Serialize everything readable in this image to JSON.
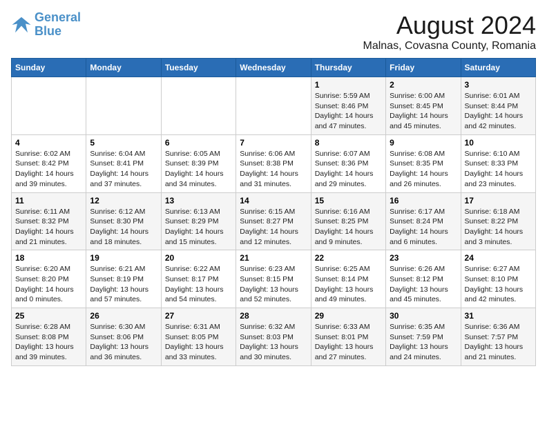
{
  "logo": {
    "line1": "General",
    "line2": "Blue"
  },
  "title": "August 2024",
  "location": "Malnas, Covasna County, Romania",
  "days_of_week": [
    "Sunday",
    "Monday",
    "Tuesday",
    "Wednesday",
    "Thursday",
    "Friday",
    "Saturday"
  ],
  "weeks": [
    [
      {
        "day": "",
        "info": ""
      },
      {
        "day": "",
        "info": ""
      },
      {
        "day": "",
        "info": ""
      },
      {
        "day": "",
        "info": ""
      },
      {
        "day": "1",
        "info": "Sunrise: 5:59 AM\nSunset: 8:46 PM\nDaylight: 14 hours and 47 minutes."
      },
      {
        "day": "2",
        "info": "Sunrise: 6:00 AM\nSunset: 8:45 PM\nDaylight: 14 hours and 45 minutes."
      },
      {
        "day": "3",
        "info": "Sunrise: 6:01 AM\nSunset: 8:44 PM\nDaylight: 14 hours and 42 minutes."
      }
    ],
    [
      {
        "day": "4",
        "info": "Sunrise: 6:02 AM\nSunset: 8:42 PM\nDaylight: 14 hours and 39 minutes."
      },
      {
        "day": "5",
        "info": "Sunrise: 6:04 AM\nSunset: 8:41 PM\nDaylight: 14 hours and 37 minutes."
      },
      {
        "day": "6",
        "info": "Sunrise: 6:05 AM\nSunset: 8:39 PM\nDaylight: 14 hours and 34 minutes."
      },
      {
        "day": "7",
        "info": "Sunrise: 6:06 AM\nSunset: 8:38 PM\nDaylight: 14 hours and 31 minutes."
      },
      {
        "day": "8",
        "info": "Sunrise: 6:07 AM\nSunset: 8:36 PM\nDaylight: 14 hours and 29 minutes."
      },
      {
        "day": "9",
        "info": "Sunrise: 6:08 AM\nSunset: 8:35 PM\nDaylight: 14 hours and 26 minutes."
      },
      {
        "day": "10",
        "info": "Sunrise: 6:10 AM\nSunset: 8:33 PM\nDaylight: 14 hours and 23 minutes."
      }
    ],
    [
      {
        "day": "11",
        "info": "Sunrise: 6:11 AM\nSunset: 8:32 PM\nDaylight: 14 hours and 21 minutes."
      },
      {
        "day": "12",
        "info": "Sunrise: 6:12 AM\nSunset: 8:30 PM\nDaylight: 14 hours and 18 minutes."
      },
      {
        "day": "13",
        "info": "Sunrise: 6:13 AM\nSunset: 8:29 PM\nDaylight: 14 hours and 15 minutes."
      },
      {
        "day": "14",
        "info": "Sunrise: 6:15 AM\nSunset: 8:27 PM\nDaylight: 14 hours and 12 minutes."
      },
      {
        "day": "15",
        "info": "Sunrise: 6:16 AM\nSunset: 8:25 PM\nDaylight: 14 hours and 9 minutes."
      },
      {
        "day": "16",
        "info": "Sunrise: 6:17 AM\nSunset: 8:24 PM\nDaylight: 14 hours and 6 minutes."
      },
      {
        "day": "17",
        "info": "Sunrise: 6:18 AM\nSunset: 8:22 PM\nDaylight: 14 hours and 3 minutes."
      }
    ],
    [
      {
        "day": "18",
        "info": "Sunrise: 6:20 AM\nSunset: 8:20 PM\nDaylight: 14 hours and 0 minutes."
      },
      {
        "day": "19",
        "info": "Sunrise: 6:21 AM\nSunset: 8:19 PM\nDaylight: 13 hours and 57 minutes."
      },
      {
        "day": "20",
        "info": "Sunrise: 6:22 AM\nSunset: 8:17 PM\nDaylight: 13 hours and 54 minutes."
      },
      {
        "day": "21",
        "info": "Sunrise: 6:23 AM\nSunset: 8:15 PM\nDaylight: 13 hours and 52 minutes."
      },
      {
        "day": "22",
        "info": "Sunrise: 6:25 AM\nSunset: 8:14 PM\nDaylight: 13 hours and 49 minutes."
      },
      {
        "day": "23",
        "info": "Sunrise: 6:26 AM\nSunset: 8:12 PM\nDaylight: 13 hours and 45 minutes."
      },
      {
        "day": "24",
        "info": "Sunrise: 6:27 AM\nSunset: 8:10 PM\nDaylight: 13 hours and 42 minutes."
      }
    ],
    [
      {
        "day": "25",
        "info": "Sunrise: 6:28 AM\nSunset: 8:08 PM\nDaylight: 13 hours and 39 minutes."
      },
      {
        "day": "26",
        "info": "Sunrise: 6:30 AM\nSunset: 8:06 PM\nDaylight: 13 hours and 36 minutes."
      },
      {
        "day": "27",
        "info": "Sunrise: 6:31 AM\nSunset: 8:05 PM\nDaylight: 13 hours and 33 minutes."
      },
      {
        "day": "28",
        "info": "Sunrise: 6:32 AM\nSunset: 8:03 PM\nDaylight: 13 hours and 30 minutes."
      },
      {
        "day": "29",
        "info": "Sunrise: 6:33 AM\nSunset: 8:01 PM\nDaylight: 13 hours and 27 minutes."
      },
      {
        "day": "30",
        "info": "Sunrise: 6:35 AM\nSunset: 7:59 PM\nDaylight: 13 hours and 24 minutes."
      },
      {
        "day": "31",
        "info": "Sunrise: 6:36 AM\nSunset: 7:57 PM\nDaylight: 13 hours and 21 minutes."
      }
    ]
  ]
}
